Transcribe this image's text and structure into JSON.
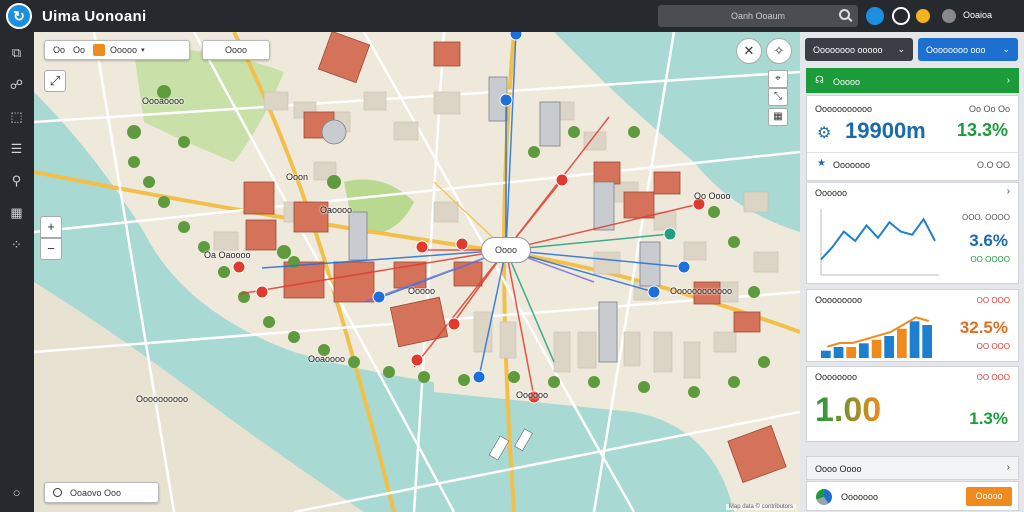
{
  "app": {
    "title": "Uima Uonoani",
    "logo_icon": "route-logo-icon"
  },
  "search": {
    "placeholder": "Oanh Ooaum"
  },
  "topbar": {
    "user_label": "Ooaioa"
  },
  "rail": {
    "icons": [
      "layers-icon",
      "route-icon",
      "analytics-icon",
      "list-icon",
      "user-location-icon",
      "building-icon",
      "grid-icon",
      "settings-icon"
    ]
  },
  "map": {
    "toolbar": {
      "buttons": [
        "Oo",
        "Oo",
        "Ooooo",
        "Oooo"
      ]
    },
    "search_pill": "Ooaovo Ooo",
    "hub_label": "Oooo",
    "labels": {
      "district_nw": "Oooaoooo",
      "north": "Ooon",
      "center_w": "Oaoooo",
      "ne": "Oo Oooo",
      "west": "Oa Oaoooo",
      "center": "Ooooo",
      "east": "Oooooooooooo",
      "south_w": "Ooaoooo",
      "sw": "Oooooooooo",
      "south": "Oooooo"
    },
    "attribution": "Map data © contributors"
  },
  "panel": {
    "header_dark_label": "Oooooooo ooooo",
    "header_blue_label": "Oooooooo ooo",
    "green_card": {
      "title": "Ooooo"
    },
    "metric1": {
      "label": "Ooooooooooo",
      "small": "Oo Oo Oo",
      "value": "19900m",
      "percent": "13.3%"
    },
    "section2": {
      "label": "Ooooooo",
      "small": "O.O OO"
    },
    "card3": {
      "title": "Oooooo",
      "small_top": "OOO. OOOO",
      "percent": "3.6%",
      "small_bottom": "OO OOOO"
    },
    "card4": {
      "title": "Ooooooooo",
      "small_top": "OO OOO",
      "percent": "32.5%",
      "small_bottom": "OO OOO"
    },
    "card5": {
      "title": "Oooooooo",
      "small_top": "OO OOO",
      "value": "1.00",
      "percent": "1.3%"
    },
    "card6": {
      "title": "Oooo Oooo",
      "row_label": "Ooooooo",
      "button_label": "Ooooo"
    }
  },
  "colors": {
    "accent_blue": "#1d6fd0",
    "accent_green": "#1c9b3a",
    "accent_orange": "#f08a1c",
    "route_red": "#e03a2f",
    "route_blue": "#1e6fd9",
    "water": "#a9d9d3"
  },
  "chart_data": [
    {
      "type": "line",
      "x": [
        0,
        1,
        2,
        3,
        4,
        5,
        6,
        7,
        8,
        9,
        10
      ],
      "values": [
        5,
        9,
        14,
        11,
        16,
        12,
        17,
        14,
        13,
        18,
        11
      ],
      "ylim": [
        0,
        20
      ]
    },
    {
      "type": "bar",
      "categories": [
        "1",
        "2",
        "3",
        "4",
        "5",
        "6",
        "7",
        "8",
        "9"
      ],
      "values": [
        2,
        3,
        3,
        4,
        5,
        6,
        8,
        10,
        9
      ],
      "ylim": [
        0,
        12
      ]
    }
  ]
}
